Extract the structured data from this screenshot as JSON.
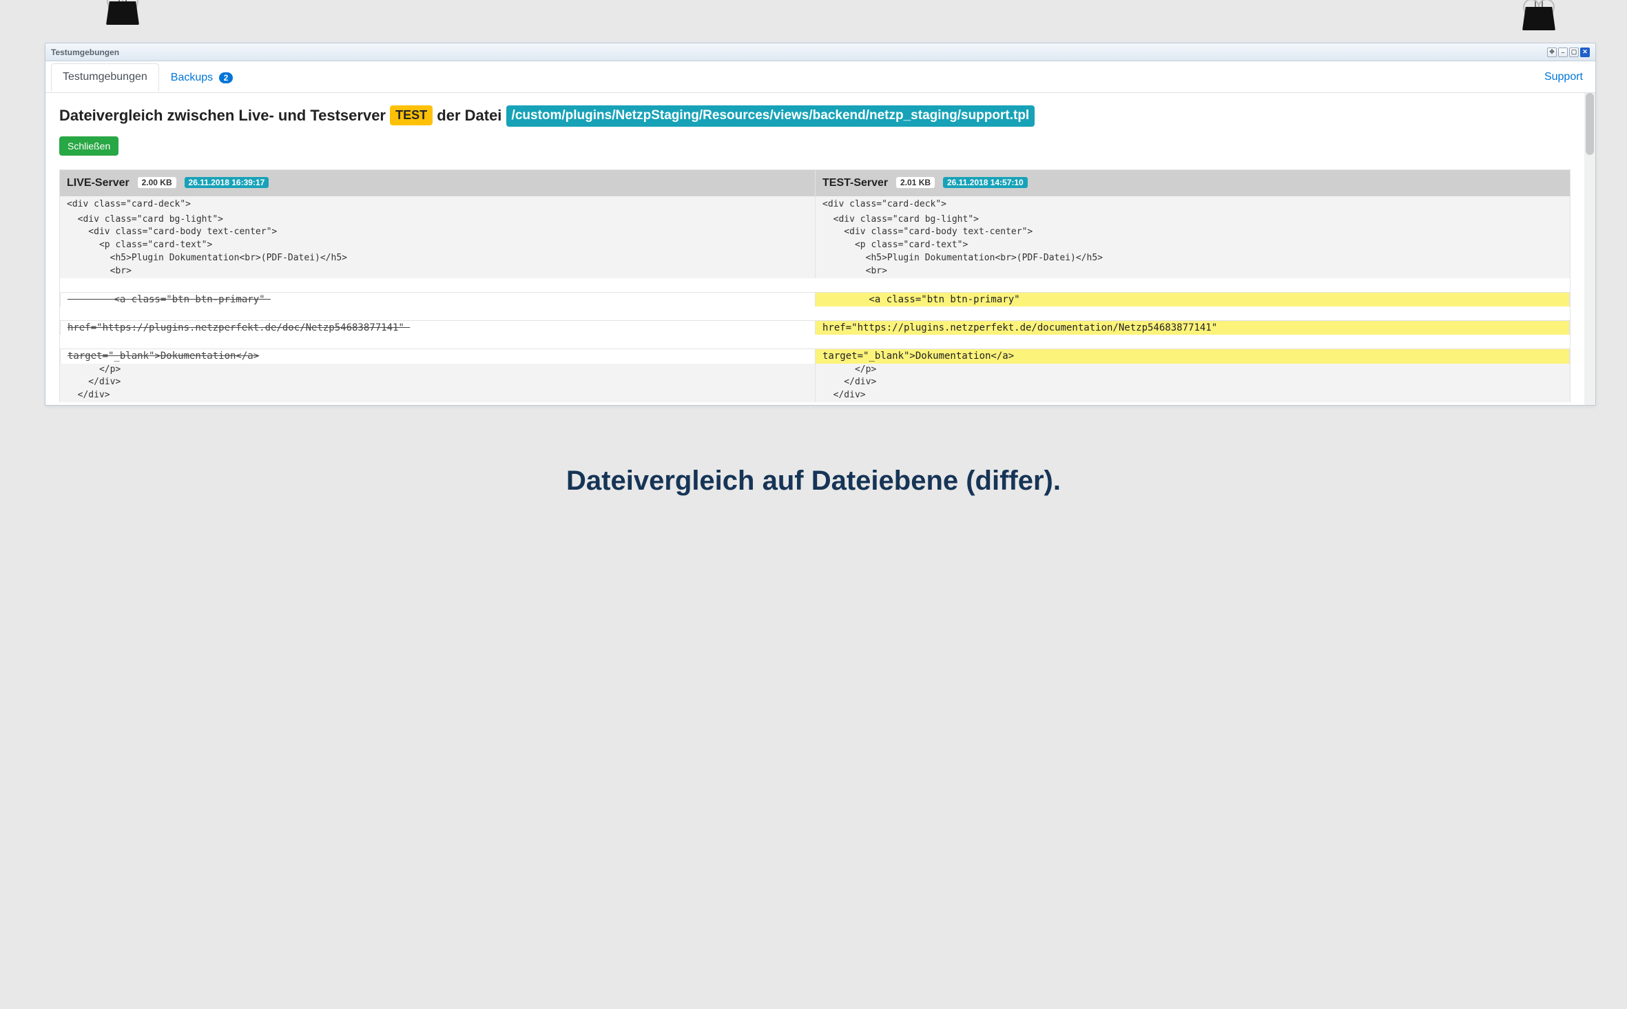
{
  "window": {
    "title": "Testumgebungen"
  },
  "tabs": {
    "active": "Testumgebungen",
    "backups_label": "Backups",
    "backups_count": "2",
    "support": "Support"
  },
  "heading": {
    "prefix": "Dateivergleich zwischen Live- und Testserver",
    "env_badge": "TEST",
    "middle": "der Datei",
    "file_path": "/custom/plugins/NetzpStaging/Resources/views/backend/netzp_staging/support.tpl"
  },
  "buttons": {
    "close": "Schließen"
  },
  "diff": {
    "left": {
      "label": "LIVE-Server",
      "size": "2.00 KB",
      "timestamp": "26.11.2018 16:39:17"
    },
    "right": {
      "label": "TEST-Server",
      "size": "2.01 KB",
      "timestamp": "26.11.2018 14:57:10"
    },
    "rows": [
      {
        "type": "normal",
        "l": "<div class=\"card-deck\">",
        "r": "<div class=\"card-deck\">"
      },
      {
        "type": "normal",
        "l": "  <div class=\"card bg-light\">",
        "r": "  <div class=\"card bg-light\">"
      },
      {
        "type": "normal",
        "l": "    <div class=\"card-body text-center\">",
        "r": "    <div class=\"card-body text-center\">"
      },
      {
        "type": "normal",
        "l": "      <p class=\"card-text\">",
        "r": "      <p class=\"card-text\">"
      },
      {
        "type": "normal",
        "l": "        <h5>Plugin Dokumentation<br>(PDF-Datei)</h5>",
        "r": "        <h5>Plugin Dokumentation<br>(PDF-Datei)</h5>"
      },
      {
        "type": "normal",
        "l": "        <br>",
        "r": "        <br>"
      },
      {
        "type": "diff",
        "l": "        <a class=\"btn btn-primary\" ",
        "r": "        <a class=\"btn btn-primary\" "
      },
      {
        "type": "diff",
        "l": "href=\"https://plugins.netzperfekt.de/doc/Netzp54683877141\" ",
        "r": "href=\"https://plugins.netzperfekt.de/documentation/Netzp54683877141\" "
      },
      {
        "type": "diff",
        "l": "target=\"_blank\">Dokumentation</a>",
        "r": "target=\"_blank\">Dokumentation</a>"
      },
      {
        "type": "normal",
        "l": "      </p>",
        "r": "      </p>"
      },
      {
        "type": "normal",
        "l": "    </div>",
        "r": "    </div>"
      },
      {
        "type": "normal",
        "l": "  </div>",
        "r": "  </div>"
      }
    ]
  },
  "caption": "Dateivergleich auf Dateiebene (differ)."
}
